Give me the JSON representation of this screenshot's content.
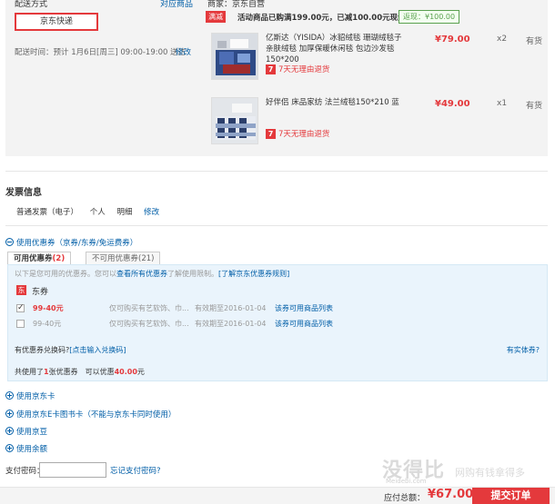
{
  "shipping": {
    "title": "配送方式",
    "gift_link": "对应商品",
    "method": "京东快递",
    "time_label": "配送时间：",
    "time_value": "预计 1月6日[周三] 09:00-19:00 送达",
    "modify": "修改"
  },
  "goods": {
    "seller": "商家：京东自营",
    "promo": {
      "badge": "满减",
      "text": "活动商品已购满199.00元，已减100.00元现金",
      "saved": "返现：¥100.00"
    },
    "items": [
      {
        "name": "亿斯达（YISIDA）冰貂绒毯 珊瑚绒毯子 亲肤绒毯 加厚保暖休闲毯 包边沙发毯 150*200",
        "price": "¥79.00",
        "qty": "x2",
        "stock": "有货",
        "return_icon": "7",
        "return_text": "7天无理由退货"
      },
      {
        "name": "好伴侣 床品家纺 法兰绒毯150*210 蓝",
        "price": "¥49.00",
        "qty": "x1",
        "stock": "有货",
        "return_icon": "7",
        "return_text": "7天无理由退货"
      }
    ]
  },
  "invoice": {
    "title": "发票信息",
    "type": "普通发票（电子）",
    "person": "个人",
    "detail": "明细",
    "modify": "修改"
  },
  "coupon": {
    "toggle": "使用优惠券（京券/东券/免运费券）",
    "tabs": [
      {
        "label": "可用优惠券",
        "count": "(2)"
      },
      {
        "label": "不可用优惠券",
        "count": "(21)"
      }
    ],
    "hint_prefix": "以下是您可用的优惠券。您可以",
    "hint_link1": "查看所有优惠券",
    "hint_mid": "了解使用限制。",
    "hint_link2": "[了解京东优惠券规则]",
    "jd_icon": "东",
    "jd_label": "东券",
    "rows": [
      {
        "checked": true,
        "amount": "99-40元",
        "scope": "仅可购买有艺软饰、巾...",
        "expiry": "有效期至2016-01-04",
        "link": "该券可用商品列表"
      },
      {
        "checked": false,
        "amount": "99-40元",
        "scope": "仅可购买有艺软饰、巾...",
        "expiry": "有效期至2016-01-04",
        "link": "该券可用商品列表"
      }
    ],
    "exchange_prefix": "有优惠券兑换码?",
    "exchange_link": "[点击输入兑换码]",
    "physical": "有实体券?",
    "total_prefix": "共使用了",
    "total_count": "1",
    "total_mid": "张优惠券　可以优惠",
    "total_amount": "40.00",
    "total_unit": "元"
  },
  "options": [
    "使用京东卡",
    "使用京东E卡图书卡（不能与京东卡同时使用）",
    "使用京豆",
    "使用余额"
  ],
  "payment": {
    "password_label": "支付密码：",
    "password_value": "",
    "forgot": "忘记支付密码?"
  },
  "watermark": {
    "main": "没得比",
    "sub": "网购有钱拿得多",
    "url": "Meidebi.com"
  },
  "footer": {
    "total_label": "应付总额：",
    "total_value": "¥67.00",
    "submit": "提交订单"
  },
  "colors": {
    "accent_red": "#e4393c",
    "link_blue": "#005ea7",
    "panel_gray": "#f3f3f3",
    "coupon_blue": "#eaf4fc"
  }
}
